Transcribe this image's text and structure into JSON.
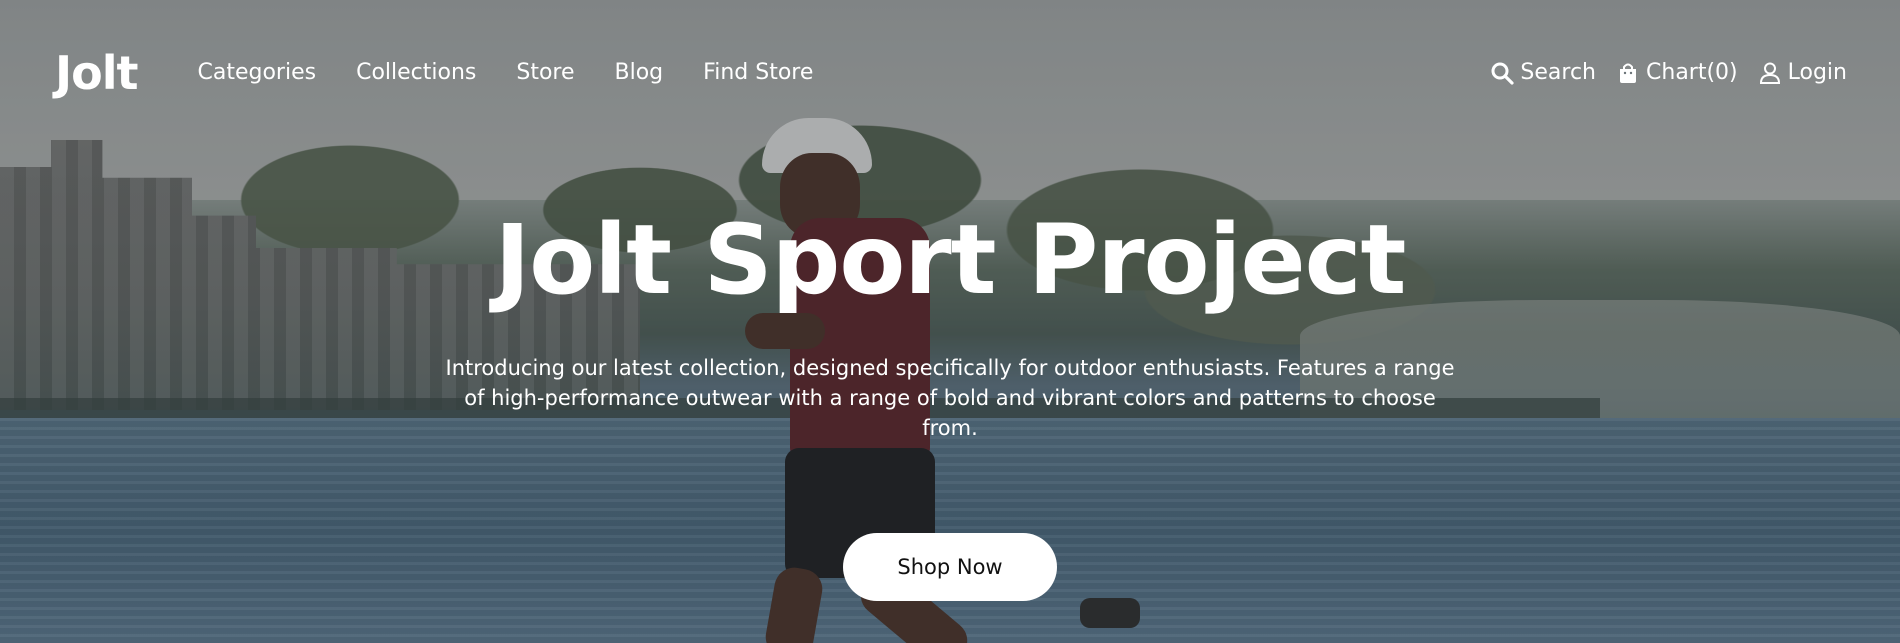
{
  "brand": {
    "logo": "Jolt"
  },
  "nav": {
    "links": [
      {
        "label": "Categories"
      },
      {
        "label": "Collections"
      },
      {
        "label": "Store"
      },
      {
        "label": "Blog"
      },
      {
        "label": "Find Store"
      }
    ],
    "actions": {
      "search": {
        "label": "Search",
        "icon": "search-icon"
      },
      "cart": {
        "label": "Chart(0)",
        "icon": "shopping-bag-icon"
      },
      "login": {
        "label": "Login",
        "icon": "user-icon"
      }
    }
  },
  "hero": {
    "title": "Jolt Sport Project",
    "description": "Introducing our latest collection, designed specifically for outdoor enthusiasts. Features a range of high-performance outwear with a range of bold and vibrant colors and patterns to choose from.",
    "cta_label": "Shop Now",
    "background_image": "runner-by-harbor"
  },
  "colors": {
    "text": "#ffffff",
    "button_bg": "#ffffff",
    "button_text": "#111111"
  }
}
